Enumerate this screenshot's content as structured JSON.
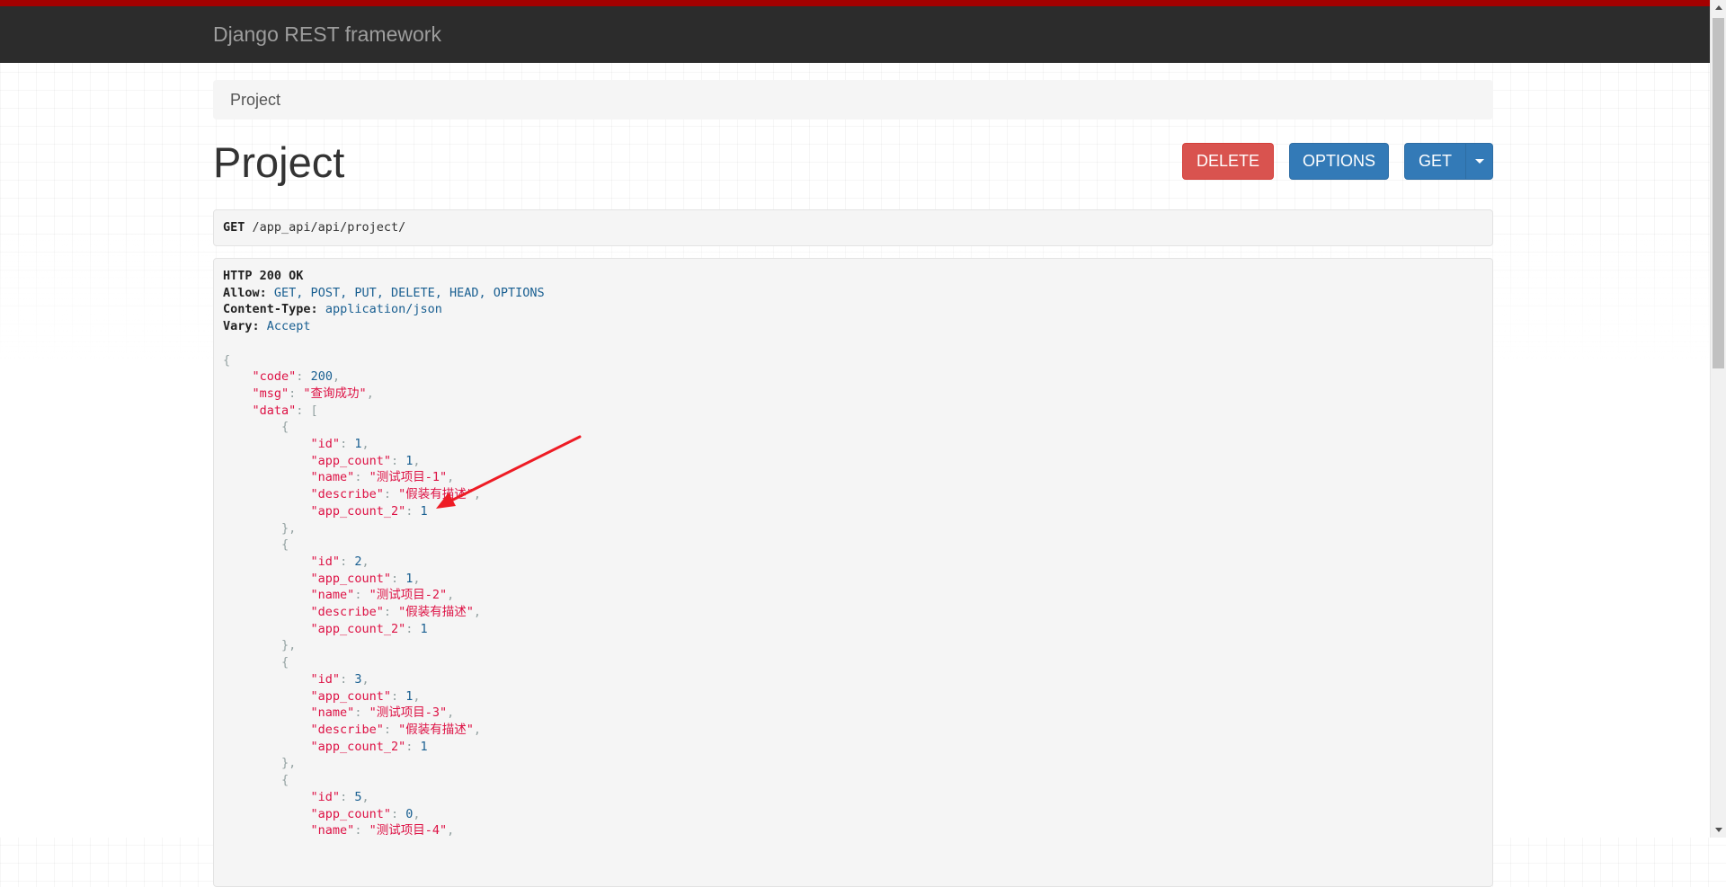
{
  "colors": {
    "top_line": "#a30000",
    "navbar_bg": "#2c2c2c",
    "brand_text": "#9d9d9d",
    "delete_button": "#d9534f",
    "primary_button": "#337ab7",
    "json_string": "#dd1144",
    "json_literal": "#195f91",
    "annotation_arrow": "#ee1c25"
  },
  "navbar": {
    "brand": "Django REST framework"
  },
  "breadcrumb": {
    "item": "Project"
  },
  "page": {
    "title": "Project"
  },
  "buttons": {
    "delete": "DELETE",
    "options": "OPTIONS",
    "get": "GET",
    "dropdown_icon": "caret-down-icon"
  },
  "request": {
    "method": "GET",
    "path": "/app_api/api/project/"
  },
  "response": {
    "status": "HTTP 200 OK",
    "headers": [
      {
        "name": "Allow:",
        "value": "GET, POST, PUT, DELETE, HEAD, OPTIONS"
      },
      {
        "name": "Content-Type:",
        "value": "application/json"
      },
      {
        "name": "Vary:",
        "value": "Accept"
      }
    ],
    "body": {
      "code_key": "\"code\"",
      "code_value": "200",
      "msg_key": "\"msg\"",
      "msg_value": "\"查询成功\"",
      "data_key": "\"data\"",
      "items": [
        {
          "id": "1",
          "app_count": "1",
          "name": "\"测试项目-1\"",
          "describe": "\"假装有描述\"",
          "app_count_2": "1"
        },
        {
          "id": "2",
          "app_count": "1",
          "name": "\"测试项目-2\"",
          "describe": "\"假装有描述\"",
          "app_count_2": "1"
        },
        {
          "id": "3",
          "app_count": "1",
          "name": "\"测试项目-3\"",
          "describe": "\"假装有描述\"",
          "app_count_2": "1"
        },
        {
          "id": "5",
          "app_count": "0",
          "name": "\"测试项目-4\""
        }
      ],
      "keys": {
        "id": "\"id\"",
        "app_count": "\"app_count\"",
        "name": "\"name\"",
        "describe": "\"describe\"",
        "app_count_2": "\"app_count_2\""
      }
    }
  }
}
